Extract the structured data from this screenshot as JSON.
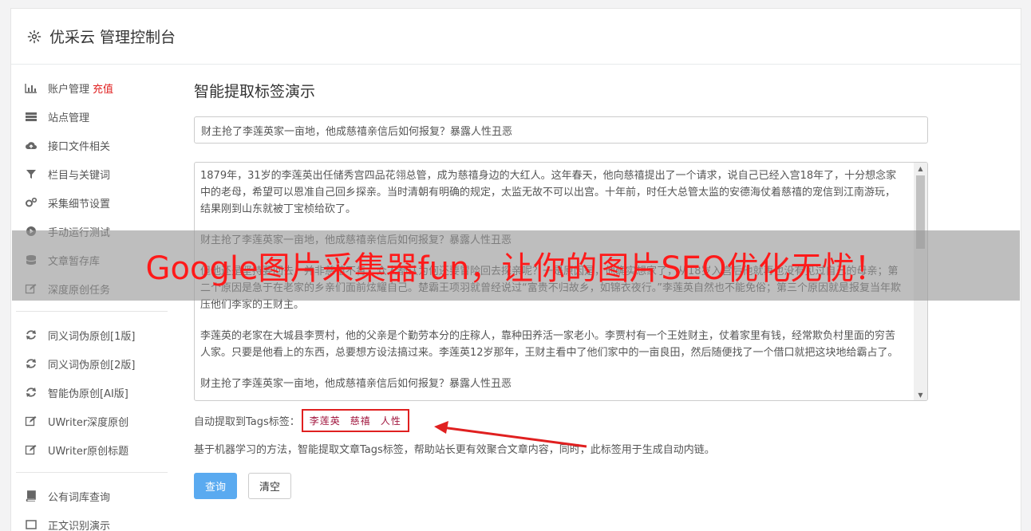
{
  "header": {
    "title": "优采云 管理控制台"
  },
  "sidebar": {
    "group1": [
      {
        "label": "账户管理",
        "icon": "bar-chart-icon",
        "badge": "充值"
      },
      {
        "label": "站点管理",
        "icon": "server-icon"
      },
      {
        "label": "接口文件相关",
        "icon": "cloud-upload-icon"
      },
      {
        "label": "栏目与关键词",
        "icon": "filter-icon"
      },
      {
        "label": "采集细节设置",
        "icon": "gears-icon"
      },
      {
        "label": "手动运行测试",
        "icon": "play-circle-icon"
      },
      {
        "label": "文章暂存库",
        "icon": "database-icon"
      },
      {
        "label": "深度原创任务",
        "icon": "edit-icon"
      }
    ],
    "group2": [
      {
        "label": "同义词伪原创[1版]",
        "icon": "refresh-icon"
      },
      {
        "label": "同义词伪原创[2版]",
        "icon": "refresh-icon"
      },
      {
        "label": "智能伪原创[AI版]",
        "icon": "refresh-icon"
      },
      {
        "label": "UWriter深度原创",
        "icon": "edit-icon"
      },
      {
        "label": "UWriter原创标题",
        "icon": "edit-icon"
      }
    ],
    "group3": [
      {
        "label": "公有词库查询",
        "icon": "book-icon"
      },
      {
        "label": "正文识别演示",
        "icon": "square-icon"
      }
    ]
  },
  "main": {
    "heading": "智能提取标签演示",
    "title_value": "财主抢了李莲英家一亩地，他成慈禧亲信后如何报复？暴露人性丑恶",
    "content_paragraphs": [
      "1879年，31岁的李莲英出任储秀宫四品花翎总管，成为慈禧身边的大红人。这年春天，他向慈禧提出了一个请求，说自己已经入宫18年了，十分想念家中的老母，希望可以恩准自己回乡探亲。当时清朝有明确的规定，太监无故不可以出宫。十年前，时任大总管太监的安德海仗着慈禧的宠信到江南游玩，结果刚到山东就被丁宝桢给砍了。",
      "财主抢了李莲英家一亩地，他成慈禧亲信后如何报复？暴露人性丑恶",
      "但他还是坚持要回去，并非慈禧不肯，众人都认为何还要冒险回去探亲呢？一是原因是，他确实想家了，从18岁入宫后他就再也没有见过自己的母亲；第二个原因是急于在老家的乡亲们面前炫耀自己。楚霸王项羽就曾经说过“富贵不归故乡，如锦衣夜行。”李莲英自然也不能免俗；第三个原因就是报复当年欺压他们李家的王财主。",
      "李莲英的老家在大城县李贾村，他的父亲是个勤劳本分的庄稼人，靠种田养活一家老小。李贾村有一个王姓财主，仗着家里有钱，经常欺负村里面的穷苦人家。只要是他看上的东西，总要想方设法搞过来。李莲英12岁那年，王财主看中了他们家中的一亩良田，然后随便找了一个借口就把这块地给霸占了。",
      "财主抢了李莲英家一亩地，他成慈禧亲信后如何报复？暴露人性丑恶"
    ],
    "tags_label": "自动提取到Tags标签：",
    "tags": [
      "李莲英",
      "慈禧",
      "人性"
    ],
    "description": "基于机器学习的方法，智能提取文章Tags标签，帮助站长更有效聚合文章内容，同时，此标签用于生成自动内链。",
    "query_button": "查询",
    "clear_button": "清空"
  },
  "banner": {
    "text": "Google图片采集器fun，让你的图片SEO优化无忧！"
  },
  "colors": {
    "primary": "#5aaaf0",
    "highlight": "#e02020",
    "tag": "#a0143c"
  }
}
